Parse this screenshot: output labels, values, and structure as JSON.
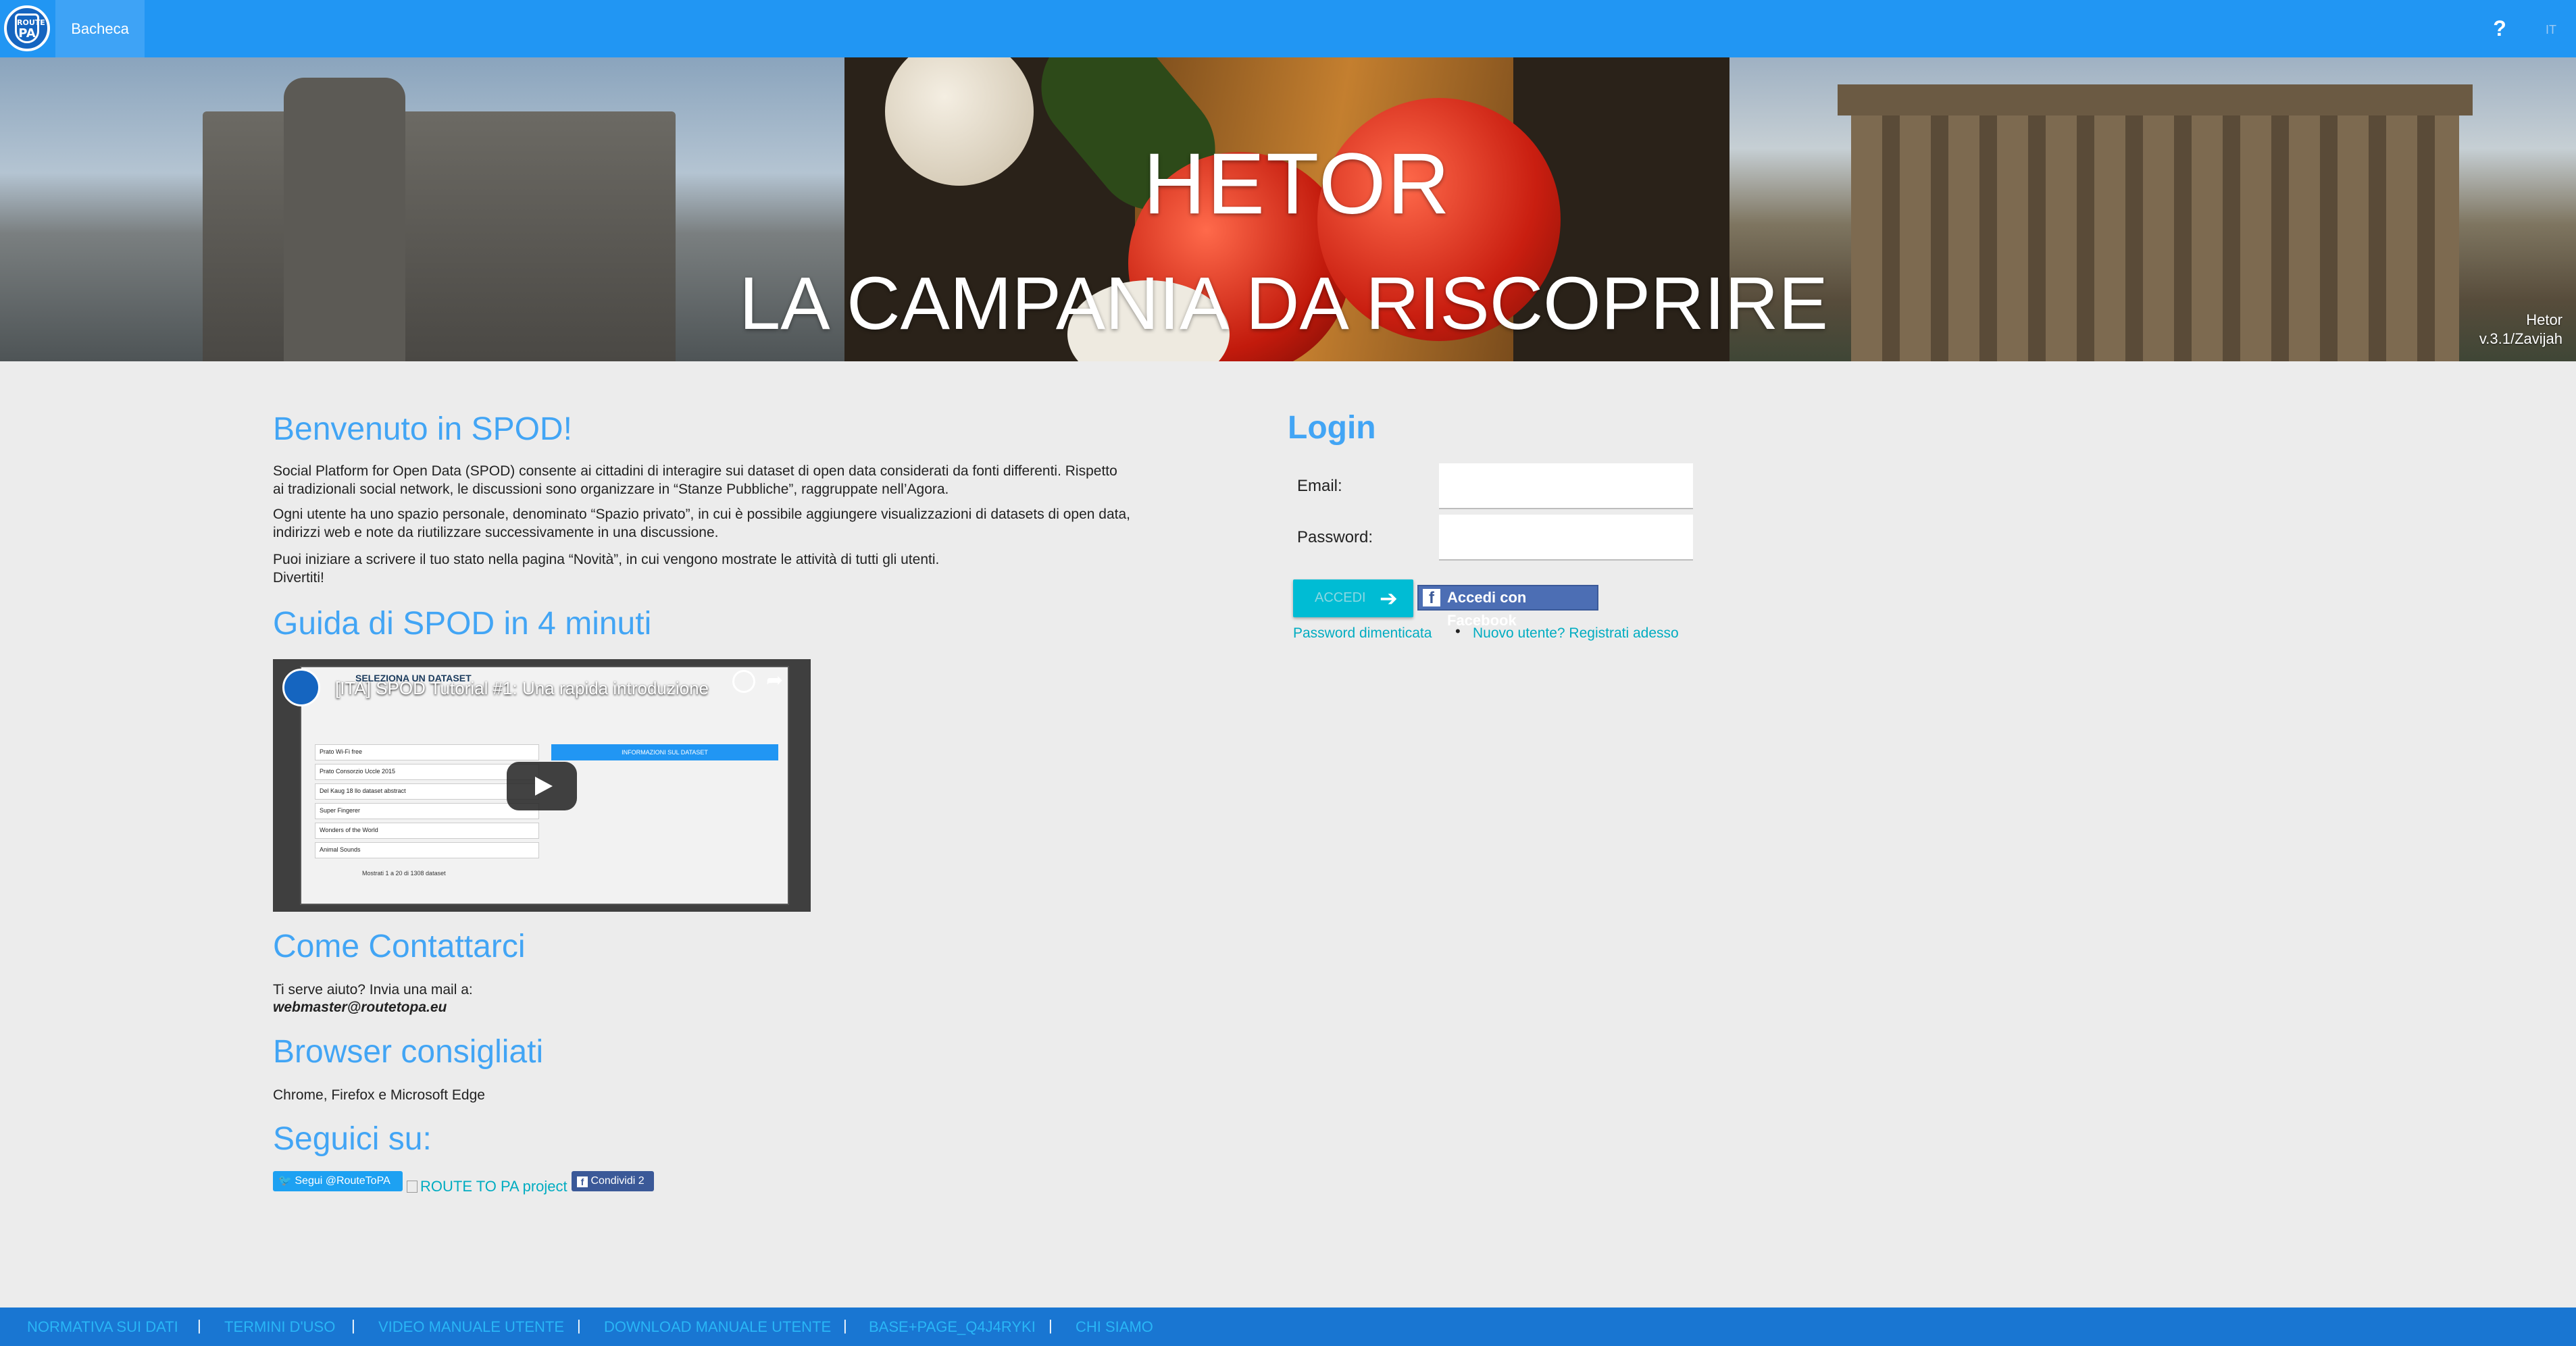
{
  "topbar": {
    "logo_text_top": "ROUTE",
    "logo_text_bottom": "PA",
    "home_tab": "Bacheca",
    "help": "?",
    "language": "IT"
  },
  "banner": {
    "title": "HETOR",
    "subtitle": "LA CAMPANIA DA RISCOPRIRE",
    "version_name": "Hetor",
    "version_number": "v.3.1/Zavijah"
  },
  "welcome": {
    "heading": "Benvenuto in SPOD!",
    "p1_line1": "Social Platform for Open Data (SPOD) consente ai cittadini di interagire sui dataset di open data considerati da fonti differenti. Rispetto",
    "p1_line2": "ai tradizionali social network, le discussioni sono organizzare in “Stanze Pubbliche”, raggruppate nell’Agora.",
    "p2_line1": "Ogni utente ha uno spazio personale, denominato “Spazio privato”, in cui è possibile aggiungere visualizzazioni di datasets di open data,",
    "p2_line2": "indirizzi web e note da riutilizzare successivamente in una discussione.",
    "p3_line1": "Puoi iniziare a scrivere il tuo stato nella pagina “Novità”, in cui vengono mostrate le attività di tutti gli utenti.",
    "p3_line2": "Divertiti!"
  },
  "guide": {
    "heading": "Guida di SPOD in 4 minuti",
    "video_title": "[ITA] SPOD Tutorial #1: Una rapida introduzione",
    "video_overlay_title": "SELEZIONA UN DATASET",
    "video_panel_title": "INFORMAZIONI SUL DATASET",
    "video_list": [
      "Prato Wi-Fi free",
      "Prato Consorzio Uccle 2015",
      "Del Kaug 18 llo dataset abstract",
      "Super Fingerer",
      "Wonders of the World",
      "Animal Sounds"
    ],
    "video_pager": "Mostrati 1 a 20 di 1308 dataset"
  },
  "contact": {
    "heading": "Come Contattarci",
    "text": "Ti serve aiuto? Invia una mail a:",
    "email": "webmaster@routetopa.eu"
  },
  "browsers": {
    "heading": "Browser consigliati",
    "text": "Chrome, Firefox e Microsoft Edge"
  },
  "follow": {
    "heading": "Seguici su:",
    "twitter": "Segui @RouteToPA",
    "project_link": "ROUTE TO PA project",
    "share": "Condividi 2"
  },
  "login": {
    "heading": "Login",
    "email_label": "Email:",
    "password_label": "Password:",
    "email_value": "",
    "password_value": "",
    "submit": "ACCEDI",
    "facebook": "Accedi con Facebook",
    "forgot": "Password dimenticata",
    "separator": "•",
    "register": "Nuovo utente? Registrati adesso"
  },
  "footer": {
    "links": [
      "NORMATIVA SUI DATI",
      "TERMINI D'USO",
      "VIDEO MANUALE UTENTE",
      "DOWNLOAD MANUALE UTENTE",
      "BASE+PAGE_Q4J4RYKI",
      "CHI SIAMO"
    ],
    "separator": "|"
  },
  "colors": {
    "topbar": "#2196f3",
    "heading": "#42a5f5",
    "link": "#00acc1",
    "footer": "#1976d2"
  }
}
